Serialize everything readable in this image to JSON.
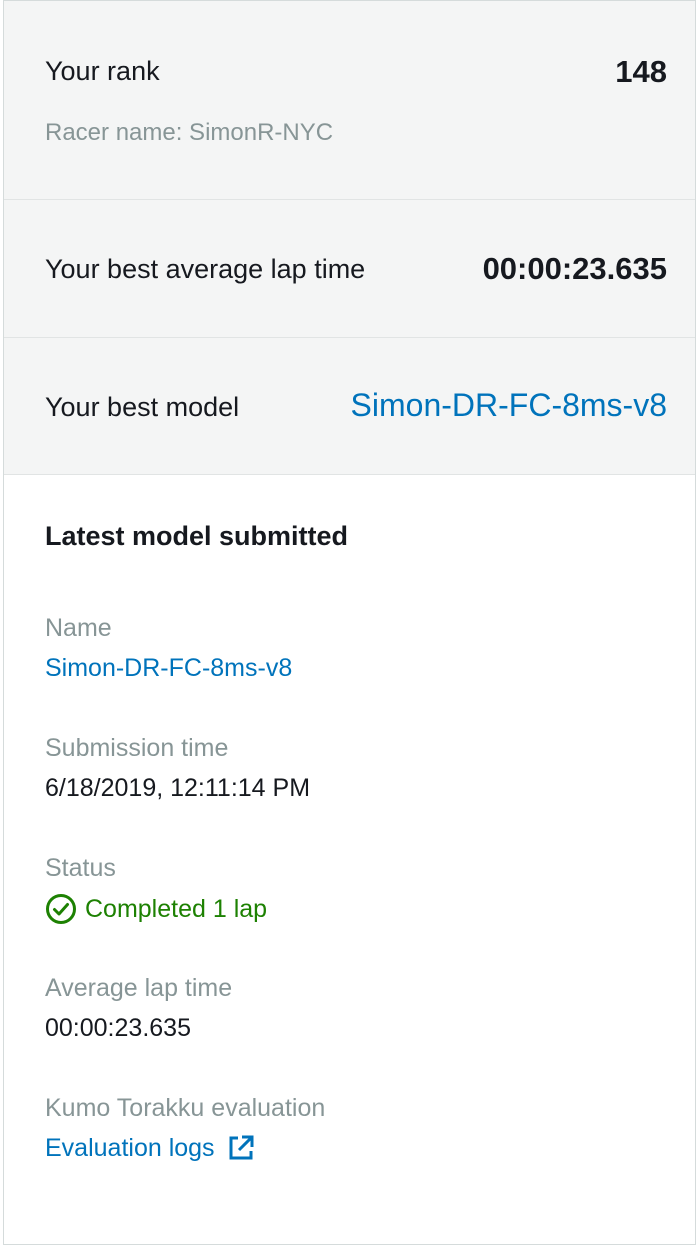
{
  "summary": {
    "rank_label": "Your rank",
    "rank_value": "148",
    "racer_name": "Racer name: SimonR-NYC",
    "best_lap_label": "Your best average lap time",
    "best_lap_value": "00:00:23.635",
    "best_model_label": "Your best model",
    "best_model_value": "Simon-DR-FC-8ms-v8"
  },
  "latest": {
    "title": "Latest model submitted",
    "name_label": "Name",
    "name_value": "Simon-DR-FC-8ms-v8",
    "submission_label": "Submission time",
    "submission_value": "6/18/2019, 12:11:14 PM",
    "status_label": "Status",
    "status_value": "Completed 1 lap",
    "status_icon": "check-circle-icon",
    "avg_lap_label": "Average lap time",
    "avg_lap_value": "00:00:23.635",
    "evaluation_label": "Kumo Torakku evaluation",
    "evaluation_link": "Evaluation logs",
    "evaluation_icon": "external-link-icon"
  },
  "colors": {
    "link": "#0073bb",
    "success": "#1d8102",
    "muted": "#879596",
    "row_background": "#f4f5f5"
  }
}
